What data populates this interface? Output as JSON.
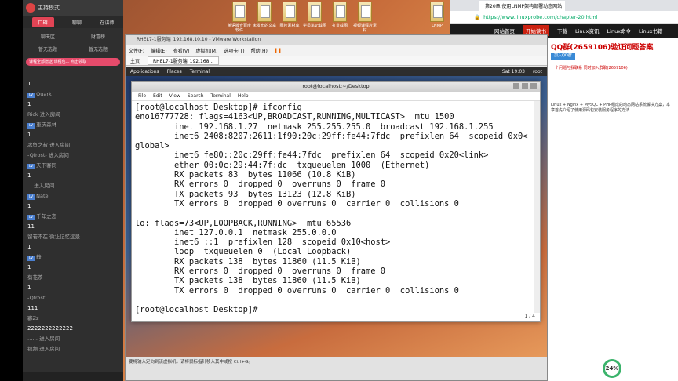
{
  "desktop": {
    "files": [
      {
        "label": "英语版查百度软件",
        "x": 0
      },
      {
        "label": "未发布的文章",
        "x": 1
      },
      {
        "label": "图片素材库",
        "x": 2
      },
      {
        "label": "学员笔记截图",
        "x": 3
      },
      {
        "label": "打赏截图",
        "x": 4
      },
      {
        "label": "视频课程片素材",
        "x": 5
      },
      {
        "label": "LNMP",
        "x": 6
      }
    ]
  },
  "chat": {
    "title": "主持模式",
    "tabs": [
      "口碑",
      "聊聊",
      "在讲师"
    ],
    "sub": [
      "聊天区",
      "财富榜",
      "暂无选题",
      "暂无选题"
    ],
    "banner": "课程全部赠送 课程包… 点击领取",
    "messages": [
      {
        "name": "",
        "text": "1"
      },
      {
        "name": "Quark",
        "lv": true,
        "text": "1"
      },
      {
        "name": "Rick 进入房间",
        "text": ""
      },
      {
        "name": "重庆森林",
        "lv": true,
        "text": "1"
      },
      {
        "name": "冰鱼之叔 进入房间",
        "text": ""
      },
      {
        "name": "-Qfrost- 进入房间",
        "text": ""
      },
      {
        "name": "天下客同",
        "lv": true,
        "text": "1"
      },
      {
        "name": "... 进入房间",
        "text": ""
      },
      {
        "name": "Nate",
        "lv": true,
        "text": "1"
      },
      {
        "name": "千年之恋",
        "lv": true,
        "text": "11"
      },
      {
        "name": "留若不在 微让记忆远景",
        "text": "1"
      },
      {
        "name": "静",
        "lv": true,
        "text": "1"
      },
      {
        "name": "菊花茶",
        "text": "1"
      },
      {
        "name": "-Qfrost",
        "text": "111"
      },
      {
        "name": "寡Zz",
        "text": "2222222222222"
      },
      {
        "name": "…… 进入房间",
        "text": ""
      },
      {
        "name": "视频 进入房间",
        "text": ""
      }
    ]
  },
  "vmware": {
    "title": "RHEL7-1服务端_192.168.10.10 - VMware Workstation",
    "menu": [
      "文件(F)",
      "编辑(E)",
      "查看(V)",
      "虚拟机(M)",
      "选项卡(T)",
      "帮助(H)"
    ],
    "tabs": [
      "主页",
      "RHEL7-1服务端_192.168..."
    ],
    "gnome": {
      "apps": "Applications",
      "places": "Places",
      "terminal": "Terminal",
      "clock": "Sat 19:03",
      "user": "root"
    },
    "status": "要将输入定向到该虚拟机，请将鼠标指针移入其中或按 Ctrl+G。"
  },
  "terminal": {
    "title": "root@localhost:~/Desktop",
    "menu": [
      "File",
      "Edit",
      "View",
      "Search",
      "Terminal",
      "Help"
    ],
    "lines": [
      "[root@localhost Desktop]# ifconfig",
      "eno16777728: flags=4163<UP,BROADCAST,RUNNING,MULTICAST>  mtu 1500",
      "        inet 192.168.1.27  netmask 255.255.255.0  broadcast 192.168.1.255",
      "        inet6 2408:8207:2611:1f90:20c:29ff:fe44:7fdc  prefixlen 64  scopeid 0x0<",
      "global>",
      "        inet6 fe80::20c:29ff:fe44:7fdc  prefixlen 64  scopeid 0x20<link>",
      "        ether 00:0c:29:44:7f:dc  txqueuelen 1000  (Ethernet)",
      "        RX packets 83  bytes 11066 (10.8 KiB)",
      "        RX errors 0  dropped 0  overruns 0  frame 0",
      "        TX packets 93  bytes 13123 (12.8 KiB)",
      "        TX errors 0  dropped 0 overruns 0  carrier 0  collisions 0",
      "",
      "lo: flags=73<UP,LOOPBACK,RUNNING>  mtu 65536",
      "        inet 127.0.0.1  netmask 255.0.0.0",
      "        inet6 ::1  prefixlen 128  scopeid 0x10<host>",
      "        loop  txqueuelen 0  (Local Loopback)",
      "        RX packets 138  bytes 11860 (11.5 KiB)",
      "        RX errors 0  dropped 0  overruns 0  frame 0",
      "        TX packets 138  bytes 11860 (11.5 KiB)",
      "        TX errors 0  dropped 0 overruns 0  carrier 0  collisions 0",
      "",
      "[root@localhost Desktop]# "
    ],
    "page": "1 / 4"
  },
  "browser": {
    "tab": "第20章 使用LNMP架构部署动态网站",
    "url": "https://www.linuxprobe.com/chapter-20.html",
    "nav": [
      "网站首页",
      "开始读书",
      "下载",
      "Linux资讯",
      "Linux命令",
      "Linux书籍"
    ],
    "qq": "QQ群(2659106)验证问题答案",
    "join": "加入QQ群",
    "tagline": "一个问题与我联系 同时加入群聊(2659106)",
    "intro": "Linux + Nginx + MySQL + PHP组成的动态网站系统解决方案，本章首先介绍了使用源码包安装服务程序的方法",
    "gauge": "24%"
  }
}
